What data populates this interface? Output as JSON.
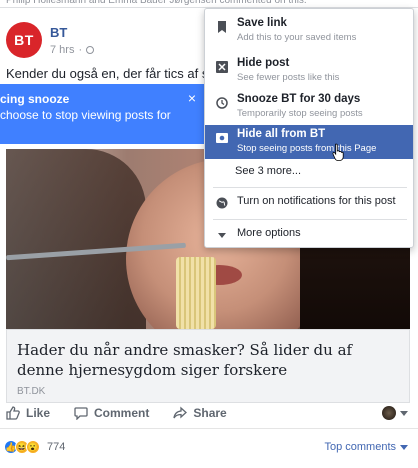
{
  "top_strip": {
    "text": "Philip Hollesmann and Emma Bauer Jørgensen commented on this."
  },
  "post": {
    "page_name": "BT",
    "avatar_text": "BT",
    "time": "7 hrs",
    "text": "Kender du også en, der får tics af sm",
    "link": {
      "title": "Hader du når andre smasker? Så lider du af denne hjernesygdom siger forskere",
      "domain": "BT.DK"
    }
  },
  "tooltip": {
    "title": "cing snooze",
    "body": "choose to stop viewing posts for",
    "close": "×"
  },
  "menu": {
    "items": [
      {
        "title": "Save link",
        "subtitle": "Add this to your saved items",
        "icon": "bookmark-icon"
      },
      {
        "title": "Hide post",
        "subtitle": "See fewer posts like this",
        "icon": "hide-icon"
      },
      {
        "title": "Snooze BT for 30 days",
        "subtitle": "Temporarily stop seeing posts",
        "icon": "clock-icon"
      },
      {
        "title": "Hide all from BT",
        "subtitle": "Stop seeing posts from this Page",
        "icon": "unfollow-icon"
      }
    ],
    "see_more": "See 3 more...",
    "notifications": "Turn on notifications for this post",
    "more_options": "More options"
  },
  "actions": {
    "like": "Like",
    "comment": "Comment",
    "share": "Share"
  },
  "reactions": {
    "count": "774",
    "top_comments": "Top comments"
  },
  "colors": {
    "accent": "#4267b2",
    "tooltip": "#4080ff",
    "brand": "#d9252a",
    "link": "#365899"
  }
}
